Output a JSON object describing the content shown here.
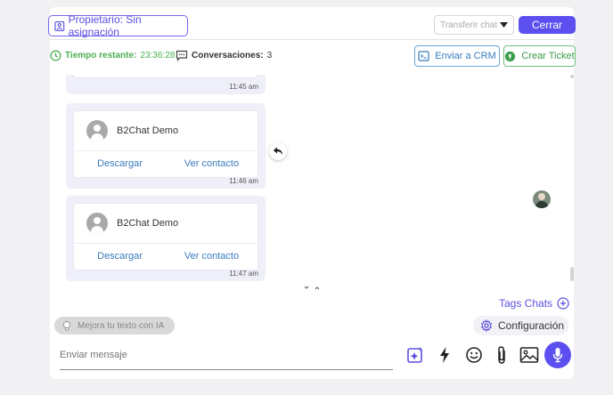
{
  "header": {
    "owner_label": "Propietario: Sin asignación",
    "transfer_placeholder": "Transferir chat",
    "close_label": "Cerrar"
  },
  "meta": {
    "time_label": "Tiempo restante:",
    "time_value": "23:36:28",
    "conversations_label": "Conversaciones:",
    "conversations_value": "3"
  },
  "actions": {
    "crm_label": "Enviar a CRM",
    "ticket_label": "Crear Ticket"
  },
  "messages": [
    {
      "time": "11:45 am"
    },
    {
      "contact_name": "B2Chat Demo",
      "download": "Descargar",
      "view": "Ver contacto",
      "time": "11:46 am"
    },
    {
      "contact_name": "B2Chat Demo",
      "download": "Descargar",
      "view": "Ver contacto",
      "time": "11:47 am"
    }
  ],
  "footer": {
    "tags_label": "Tags Chats",
    "config_label": "Configuración",
    "ai_label": "Mejora tu texto con IA",
    "message_placeholder": "Enviar mensaje"
  },
  "colors": {
    "accent": "#5b4ff0",
    "green": "#3c9c4c",
    "blue": "#3a7bbf"
  }
}
